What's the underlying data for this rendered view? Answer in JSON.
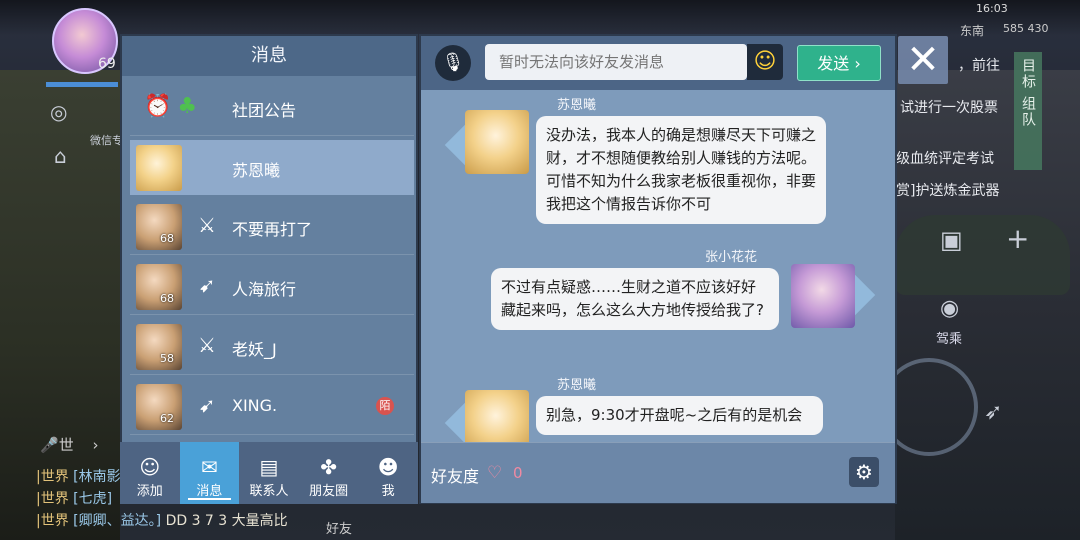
{
  "top": {
    "level": "69",
    "time": "16:03",
    "coords": "585 430",
    "direction": "东南",
    "weixin": "微信专"
  },
  "right_quests": [
    "，前往",
    "试进行一次股票",
    "级血统评定考试",
    "赏]护送炼金武器"
  ],
  "goal_tabs": [
    "目标",
    "组队"
  ],
  "drive_label": "驾乘",
  "messages_panel": {
    "title": "消息",
    "announcement": "社团公告",
    "conversations": [
      {
        "name": "苏恩曦",
        "level": "",
        "active": true
      },
      {
        "name": "不要再打了",
        "level": "68"
      },
      {
        "name": "人海旅行",
        "level": "68"
      },
      {
        "name": "老妖_J",
        "level": "58"
      },
      {
        "name": "XING.",
        "level": "62",
        "badge": "陌"
      }
    ]
  },
  "tabs": [
    {
      "label": "添加",
      "icon": "add-friend-icon"
    },
    {
      "label": "消息",
      "icon": "message-icon",
      "active": true
    },
    {
      "label": "联系人",
      "icon": "contacts-icon"
    },
    {
      "label": "朋友圈",
      "icon": "moments-icon"
    },
    {
      "label": "我",
      "icon": "me-icon"
    }
  ],
  "chat": {
    "input_placeholder": "暂时无法向该好友发消息",
    "send_label": "发送",
    "messages": [
      {
        "sender": "苏恩曦",
        "side": "left",
        "text": "没办法，我本人的确是想赚尽天下可赚之财，才不想随便教给别人赚钱的方法呢。可惜不知为什么我家老板很重视你，非要我把这个情报告诉你不可"
      },
      {
        "sender": "张小花花",
        "side": "right",
        "text": "不过有点疑惑……生财之道不应该好好藏起来吗，怎么这么大方地传授给我了?"
      },
      {
        "sender": "苏恩曦",
        "side": "left",
        "text": "别急，9:30才开盘呢~之后有的是机会"
      }
    ],
    "friendship_label": "好友度",
    "friendship_value": "0"
  },
  "bottom_chat": [
    {
      "channel": "|世界",
      "name": "[林南影"
    },
    {
      "channel": "|世界",
      "name": "[七虎]"
    },
    {
      "channel": "|世界",
      "name": "[卿卿、益达。]",
      "text": "DD 3 7 3 大量高比"
    }
  ],
  "mic_label": "世",
  "friend_bottom": "好友",
  "colors": {
    "send": "#2fb28c",
    "active_tab": "#4aa1d8",
    "panel": "#7e9bbb"
  }
}
